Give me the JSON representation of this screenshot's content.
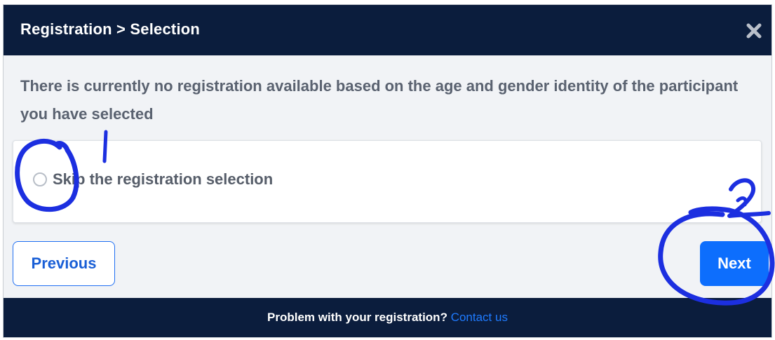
{
  "header": {
    "title": "Registration > Selection",
    "close_icon": "close-icon"
  },
  "message": "There is currently no registration available based on the age and gender identity of the participant you have selected",
  "option": {
    "label": "Skip the registration selection",
    "selected": false
  },
  "buttons": {
    "previous_label": "Previous",
    "next_label": "Next"
  },
  "footer": {
    "text": "Problem with your registration?",
    "link_text": "Contact us"
  },
  "annotations": {
    "mark_one": "1",
    "mark_two": "2",
    "color": "#1c2fe0"
  },
  "colors": {
    "header_bg": "#0b1d3d",
    "primary": "#0d6efd",
    "link": "#1f7bff"
  }
}
